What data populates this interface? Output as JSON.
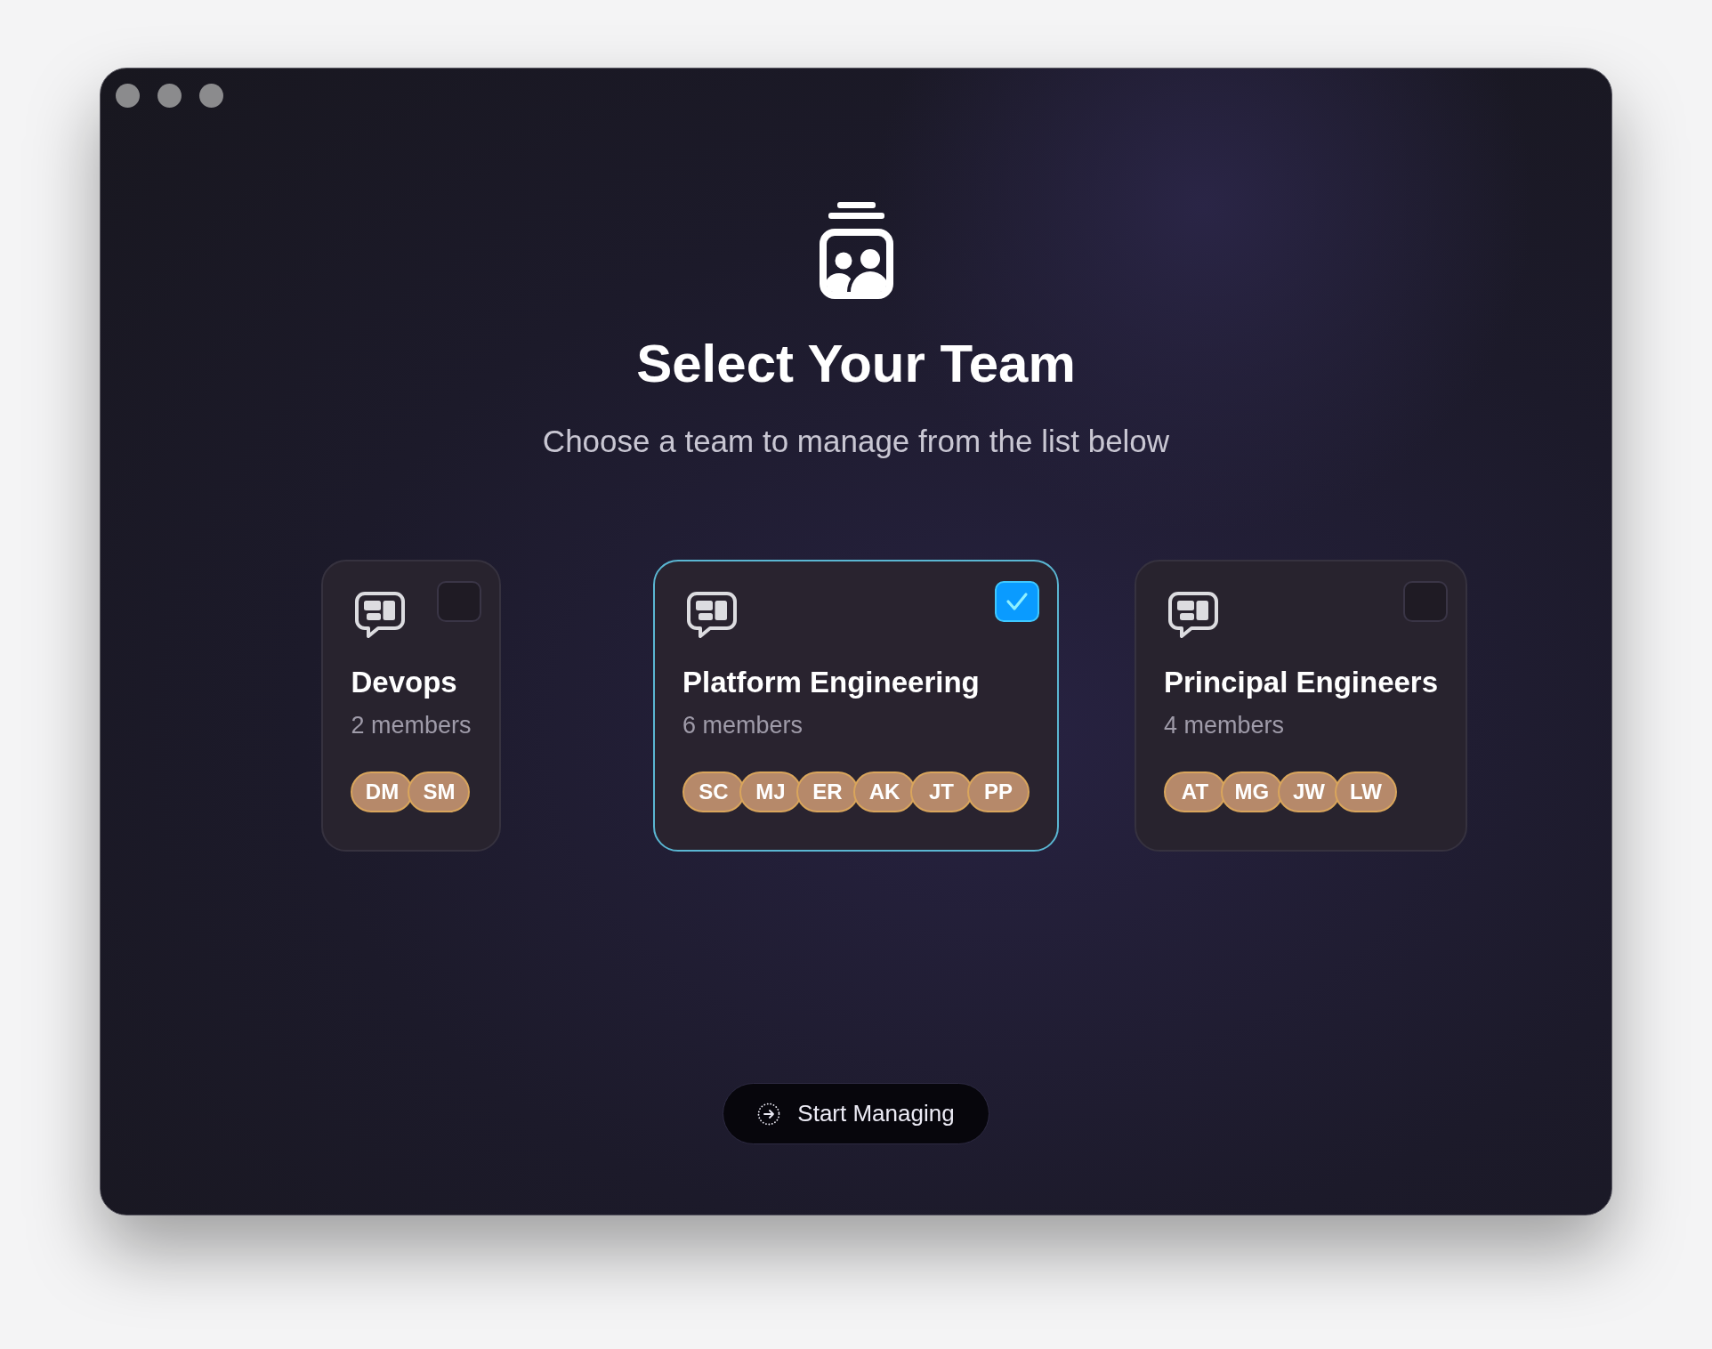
{
  "header": {
    "title": "Select Your Team",
    "subtitle": "Choose a team to manage from the list below"
  },
  "teams": [
    {
      "name": "Devops",
      "member_count": "2 members",
      "selected": false,
      "members": [
        "DM",
        "SM"
      ]
    },
    {
      "name": "Platform Engineering",
      "member_count": "6 members",
      "selected": true,
      "members": [
        "SC",
        "MJ",
        "ER",
        "AK",
        "JT",
        "PP"
      ]
    },
    {
      "name": "Principal Engineers",
      "member_count": "4 members",
      "selected": false,
      "members": [
        "AT",
        "MG",
        "JW",
        "LW"
      ]
    }
  ],
  "primary_button": {
    "label": "Start Managing"
  }
}
